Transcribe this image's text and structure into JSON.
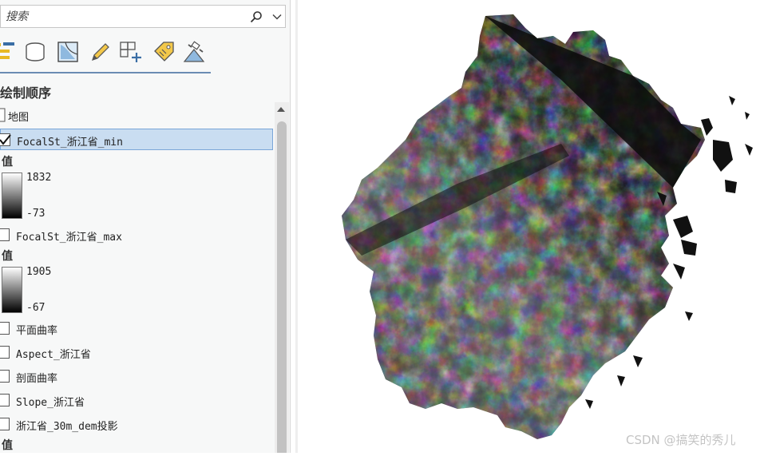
{
  "search": {
    "placeholder": "搜索"
  },
  "toolbar": {
    "icons": [
      "list-by-drawing-order-icon",
      "list-by-source-icon",
      "list-by-selection-icon",
      "list-by-editing-icon",
      "list-by-snapping-icon",
      "list-by-labeling-icon",
      "list-by-perspective-imagery-icon"
    ]
  },
  "contents": {
    "title": "绘制顺序",
    "map_label": "地图",
    "layers": [
      {
        "label": "FocalSt_浙江省_min",
        "checked": true,
        "selected": true,
        "legend_heading": "值",
        "legend_max": "1832",
        "legend_min": "-73"
      },
      {
        "label": "FocalSt_浙江省_max",
        "checked": false,
        "legend_heading": "值",
        "legend_max": "1905",
        "legend_min": "-67"
      },
      {
        "label": "平面曲率",
        "checked": false
      },
      {
        "label": "Aspect_浙江省",
        "checked": false
      },
      {
        "label": "剖面曲率",
        "checked": false
      },
      {
        "label": "Slope_浙江省",
        "checked": false
      },
      {
        "label": "浙江省_30m_dem投影",
        "checked": false,
        "legend_heading": "值"
      }
    ]
  },
  "watermark": "CSDN @搞笑的秀儿",
  "colors": {
    "selection": "#c9ddf1",
    "selection_border": "#7aa6d8",
    "accent": "#6b8cb3"
  }
}
